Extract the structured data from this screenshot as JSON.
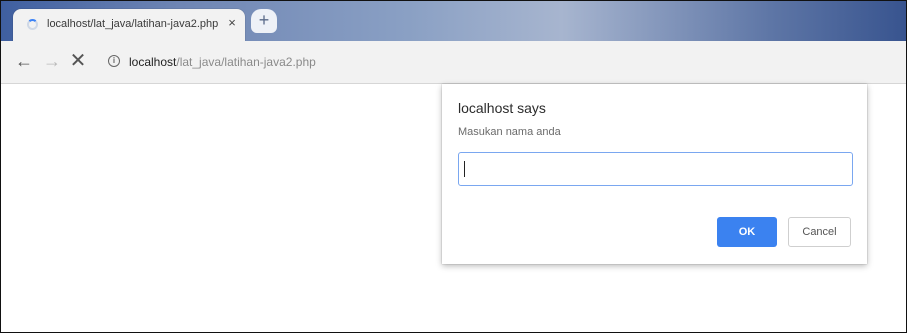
{
  "browser": {
    "tab": {
      "title": "localhost/lat_java/latihan-java2.php",
      "close_label": "×"
    },
    "new_tab_label": "+",
    "nav": {
      "back_icon": "arrow-left-icon",
      "forward_icon": "arrow-right-icon",
      "stop_icon": "close-icon",
      "back_glyph": "←",
      "forward_glyph": "→",
      "stop_glyph": "✕"
    },
    "address": {
      "info_glyph": "i",
      "host": "localhost",
      "path": "/lat_java/latihan-java2.php"
    }
  },
  "dialog": {
    "title": "localhost says",
    "message": "Masukan nama anda",
    "input_value": "",
    "ok_label": "OK",
    "cancel_label": "Cancel"
  },
  "colors": {
    "accent": "#3b82f0",
    "input_border": "#7aa7f0"
  }
}
